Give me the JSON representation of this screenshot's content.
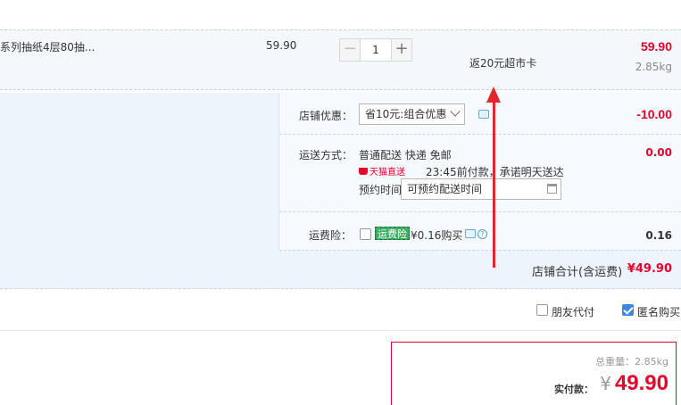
{
  "item": {
    "name": "系列抽纸4层80抽...",
    "unit_price": "59.90",
    "quantity": "1",
    "qty_minus": "−",
    "qty_plus": "+",
    "cashback": "返20元超市卡",
    "subtotal": "59.90",
    "weight": "2.85kg"
  },
  "promo": {
    "label": "店铺优惠：",
    "selected": "省10元:组合优惠",
    "amount": "-10.00"
  },
  "shipping": {
    "label": "运送方式：",
    "method": "普通配送 快递 免邮",
    "badge": "天猫直送",
    "notice": "23:45前付款，承诺明天送达",
    "schedule_label": "预约时间",
    "schedule_placeholder": "可预约配送时间",
    "fee": "0.00"
  },
  "insurance": {
    "label": "运费险：",
    "tag": "运费险",
    "price": "¥0.16购买",
    "fee": "0.16"
  },
  "shop_total": {
    "label": "店铺合计(含运费)",
    "amount": "¥49.90"
  },
  "options": {
    "friend_pay": "朋友代付",
    "anonymous": "匿名购买"
  },
  "payment": {
    "total_weight": "总重量：2.85kg",
    "label": "实付款：",
    "currency": "¥",
    "amount": "49.90"
  },
  "colors": {
    "price_red": "#e4002b",
    "panel_blue": "#eef4fb",
    "accent_blue": "#3b86e0",
    "insurance_green": "#3aaf61"
  }
}
